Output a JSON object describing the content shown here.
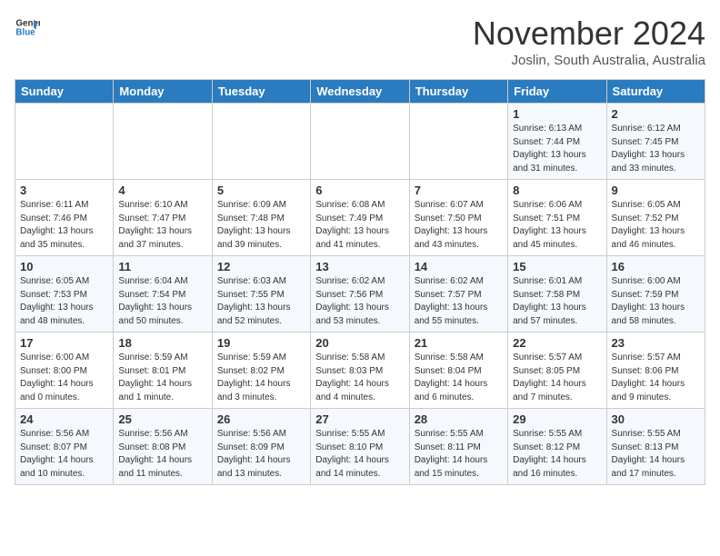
{
  "header": {
    "logo_line1": "General",
    "logo_line2": "Blue",
    "month_title": "November 2024",
    "location": "Joslin, South Australia, Australia"
  },
  "weekdays": [
    "Sunday",
    "Monday",
    "Tuesday",
    "Wednesday",
    "Thursday",
    "Friday",
    "Saturday"
  ],
  "weeks": [
    [
      {
        "day": "",
        "info": ""
      },
      {
        "day": "",
        "info": ""
      },
      {
        "day": "",
        "info": ""
      },
      {
        "day": "",
        "info": ""
      },
      {
        "day": "",
        "info": ""
      },
      {
        "day": "1",
        "info": "Sunrise: 6:13 AM\nSunset: 7:44 PM\nDaylight: 13 hours\nand 31 minutes."
      },
      {
        "day": "2",
        "info": "Sunrise: 6:12 AM\nSunset: 7:45 PM\nDaylight: 13 hours\nand 33 minutes."
      }
    ],
    [
      {
        "day": "3",
        "info": "Sunrise: 6:11 AM\nSunset: 7:46 PM\nDaylight: 13 hours\nand 35 minutes."
      },
      {
        "day": "4",
        "info": "Sunrise: 6:10 AM\nSunset: 7:47 PM\nDaylight: 13 hours\nand 37 minutes."
      },
      {
        "day": "5",
        "info": "Sunrise: 6:09 AM\nSunset: 7:48 PM\nDaylight: 13 hours\nand 39 minutes."
      },
      {
        "day": "6",
        "info": "Sunrise: 6:08 AM\nSunset: 7:49 PM\nDaylight: 13 hours\nand 41 minutes."
      },
      {
        "day": "7",
        "info": "Sunrise: 6:07 AM\nSunset: 7:50 PM\nDaylight: 13 hours\nand 43 minutes."
      },
      {
        "day": "8",
        "info": "Sunrise: 6:06 AM\nSunset: 7:51 PM\nDaylight: 13 hours\nand 45 minutes."
      },
      {
        "day": "9",
        "info": "Sunrise: 6:05 AM\nSunset: 7:52 PM\nDaylight: 13 hours\nand 46 minutes."
      }
    ],
    [
      {
        "day": "10",
        "info": "Sunrise: 6:05 AM\nSunset: 7:53 PM\nDaylight: 13 hours\nand 48 minutes."
      },
      {
        "day": "11",
        "info": "Sunrise: 6:04 AM\nSunset: 7:54 PM\nDaylight: 13 hours\nand 50 minutes."
      },
      {
        "day": "12",
        "info": "Sunrise: 6:03 AM\nSunset: 7:55 PM\nDaylight: 13 hours\nand 52 minutes."
      },
      {
        "day": "13",
        "info": "Sunrise: 6:02 AM\nSunset: 7:56 PM\nDaylight: 13 hours\nand 53 minutes."
      },
      {
        "day": "14",
        "info": "Sunrise: 6:02 AM\nSunset: 7:57 PM\nDaylight: 13 hours\nand 55 minutes."
      },
      {
        "day": "15",
        "info": "Sunrise: 6:01 AM\nSunset: 7:58 PM\nDaylight: 13 hours\nand 57 minutes."
      },
      {
        "day": "16",
        "info": "Sunrise: 6:00 AM\nSunset: 7:59 PM\nDaylight: 13 hours\nand 58 minutes."
      }
    ],
    [
      {
        "day": "17",
        "info": "Sunrise: 6:00 AM\nSunset: 8:00 PM\nDaylight: 14 hours\nand 0 minutes."
      },
      {
        "day": "18",
        "info": "Sunrise: 5:59 AM\nSunset: 8:01 PM\nDaylight: 14 hours\nand 1 minute."
      },
      {
        "day": "19",
        "info": "Sunrise: 5:59 AM\nSunset: 8:02 PM\nDaylight: 14 hours\nand 3 minutes."
      },
      {
        "day": "20",
        "info": "Sunrise: 5:58 AM\nSunset: 8:03 PM\nDaylight: 14 hours\nand 4 minutes."
      },
      {
        "day": "21",
        "info": "Sunrise: 5:58 AM\nSunset: 8:04 PM\nDaylight: 14 hours\nand 6 minutes."
      },
      {
        "day": "22",
        "info": "Sunrise: 5:57 AM\nSunset: 8:05 PM\nDaylight: 14 hours\nand 7 minutes."
      },
      {
        "day": "23",
        "info": "Sunrise: 5:57 AM\nSunset: 8:06 PM\nDaylight: 14 hours\nand 9 minutes."
      }
    ],
    [
      {
        "day": "24",
        "info": "Sunrise: 5:56 AM\nSunset: 8:07 PM\nDaylight: 14 hours\nand 10 minutes."
      },
      {
        "day": "25",
        "info": "Sunrise: 5:56 AM\nSunset: 8:08 PM\nDaylight: 14 hours\nand 11 minutes."
      },
      {
        "day": "26",
        "info": "Sunrise: 5:56 AM\nSunset: 8:09 PM\nDaylight: 14 hours\nand 13 minutes."
      },
      {
        "day": "27",
        "info": "Sunrise: 5:55 AM\nSunset: 8:10 PM\nDaylight: 14 hours\nand 14 minutes."
      },
      {
        "day": "28",
        "info": "Sunrise: 5:55 AM\nSunset: 8:11 PM\nDaylight: 14 hours\nand 15 minutes."
      },
      {
        "day": "29",
        "info": "Sunrise: 5:55 AM\nSunset: 8:12 PM\nDaylight: 14 hours\nand 16 minutes."
      },
      {
        "day": "30",
        "info": "Sunrise: 5:55 AM\nSunset: 8:13 PM\nDaylight: 14 hours\nand 17 minutes."
      }
    ]
  ]
}
